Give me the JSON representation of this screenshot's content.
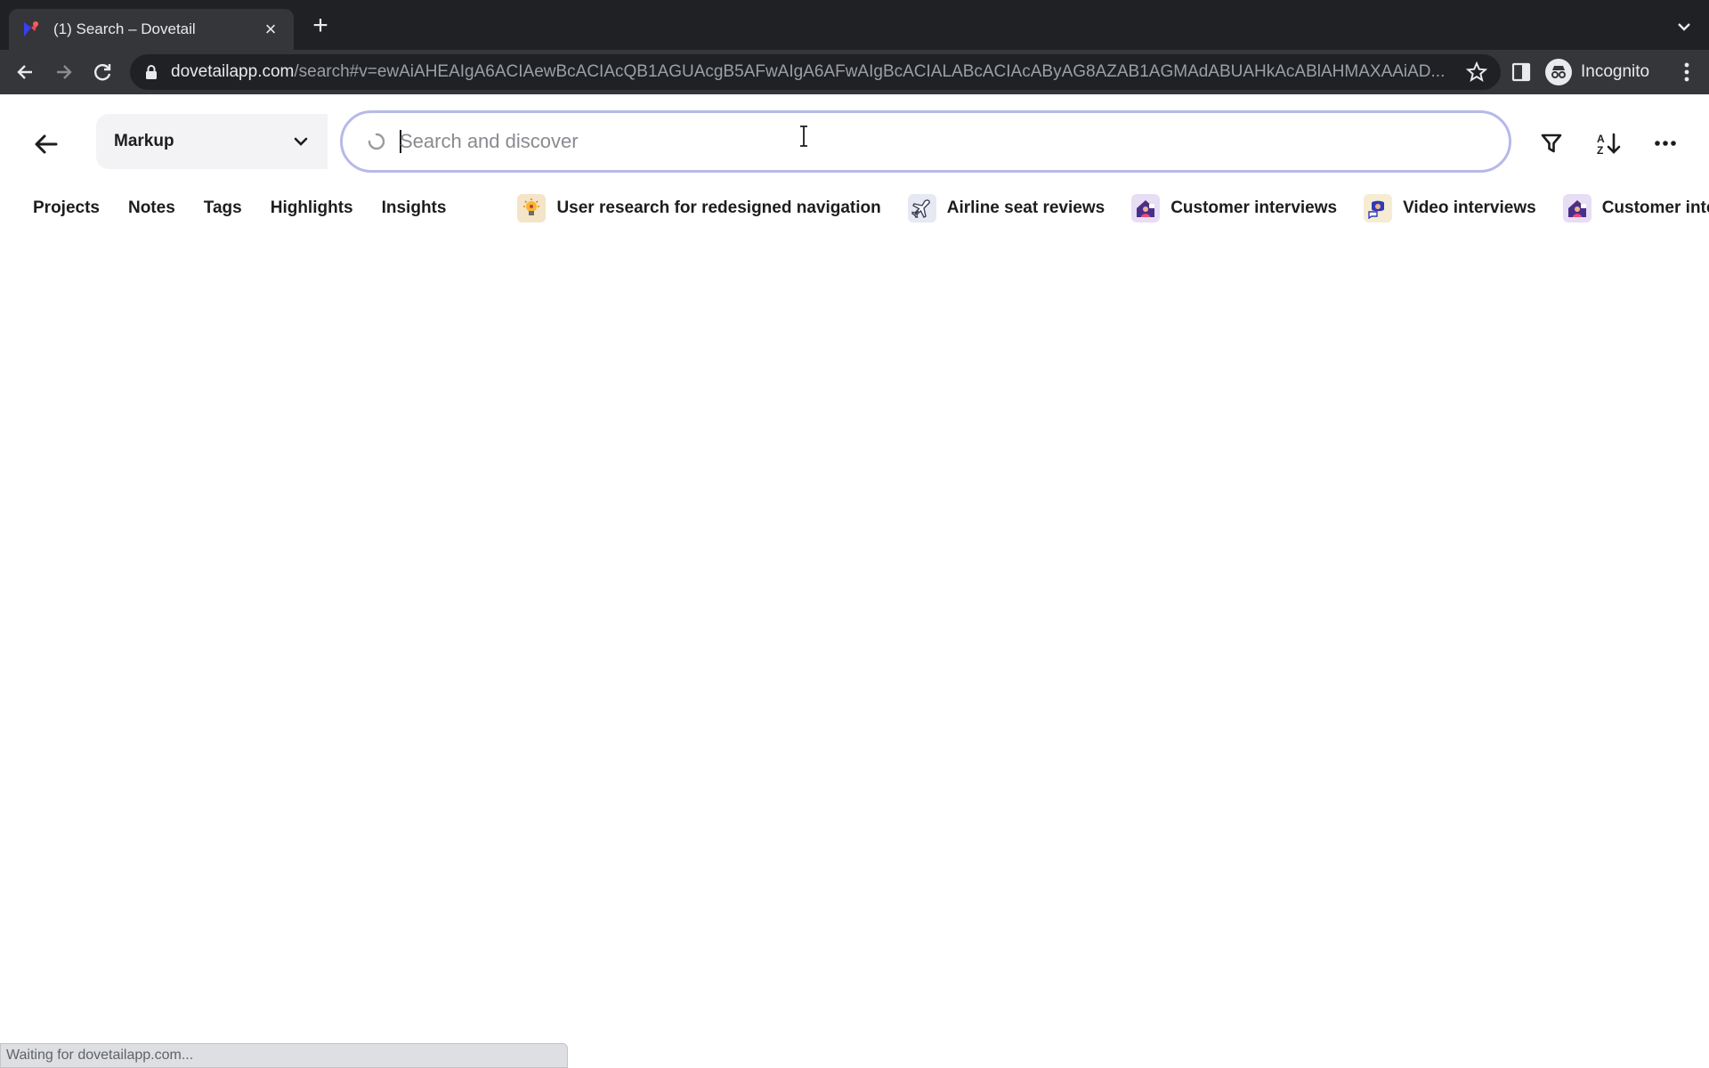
{
  "browser": {
    "tab_title": "(1) Search – Dovetail",
    "url_host": "dovetailapp.com",
    "url_path": "/search#v=ewAiAHEAIgA6ACIAewBcACIAcQB1AGUAcgB5AFwAIgA6AFwAIgBcACIALABcACIAcAByAG8AZAB1AGMAdABUAHkAcABlAHMAXAAiAD...",
    "profile_label": "Incognito",
    "status_text": "Waiting for dovetailapp.com..."
  },
  "header": {
    "workspace": "Markup",
    "search_placeholder": "Search and discover"
  },
  "filters": {
    "links": [
      "Projects",
      "Notes",
      "Tags",
      "Highlights",
      "Insights"
    ],
    "projects": [
      {
        "label": "User research for redesigned navigation",
        "icon": "lightbulb-icon",
        "color": "#f4e4c8"
      },
      {
        "label": "Airline seat reviews",
        "icon": "airplane-icon",
        "color": "#e6e8f4"
      },
      {
        "label": "Customer interviews",
        "icon": "house-icon",
        "color": "#e7ddf4"
      },
      {
        "label": "Video interviews",
        "icon": "chat-bubble-icon",
        "color": "#f6ecd4"
      },
      {
        "label": "Customer inte",
        "icon": "house-icon",
        "color": "#e7ddf4"
      }
    ]
  },
  "colors": {
    "search_border": "#b7b9e8",
    "chrome_dark": "#202124"
  }
}
